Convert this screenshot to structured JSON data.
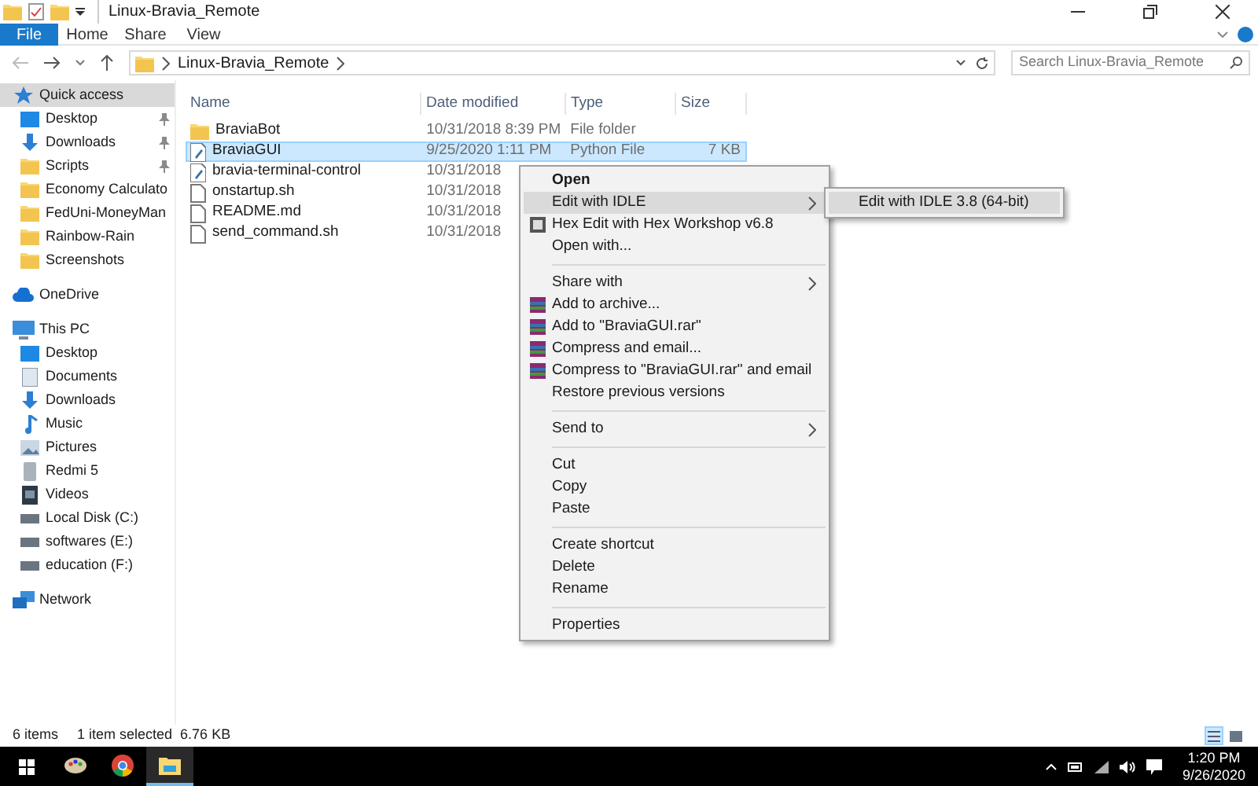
{
  "window": {
    "title": "Linux-Bravia_Remote"
  },
  "ribbon_tabs": [
    {
      "label": "File",
      "selected": true
    },
    {
      "label": "Home",
      "selected": false
    },
    {
      "label": "Share",
      "selected": false
    },
    {
      "label": "View",
      "selected": false
    }
  ],
  "address": {
    "path": "Linux-Bravia_Remote",
    "search_placeholder": "Search Linux-Bravia_Remote"
  },
  "nav": [
    {
      "label": "Quick access",
      "kind": "star",
      "selected": true,
      "children": [
        {
          "label": "Desktop",
          "kind": "desktop",
          "pinned": true
        },
        {
          "label": "Downloads",
          "kind": "download",
          "pinned": true
        },
        {
          "label": "Scripts",
          "kind": "folder",
          "pinned": true
        },
        {
          "label": "Economy Calculato",
          "kind": "folder",
          "pinned": false
        },
        {
          "label": "FedUni-MoneyMan",
          "kind": "folder",
          "pinned": false
        },
        {
          "label": "Rainbow-Rain",
          "kind": "folder",
          "pinned": false
        },
        {
          "label": "Screenshots",
          "kind": "folder",
          "pinned": false
        }
      ]
    },
    {
      "label": "OneDrive",
      "kind": "cloud",
      "selected": false
    },
    {
      "label": "This PC",
      "kind": "pc",
      "selected": false,
      "children": [
        {
          "label": "Desktop",
          "kind": "desktop"
        },
        {
          "label": "Documents",
          "kind": "document"
        },
        {
          "label": "Downloads",
          "kind": "download"
        },
        {
          "label": "Music",
          "kind": "music"
        },
        {
          "label": "Pictures",
          "kind": "pictures"
        },
        {
          "label": "Redmi 5",
          "kind": "phone"
        },
        {
          "label": "Videos",
          "kind": "video"
        },
        {
          "label": "Local Disk (C:)",
          "kind": "drive"
        },
        {
          "label": "softwares (E:)",
          "kind": "drive"
        },
        {
          "label": "education (F:)",
          "kind": "drive"
        }
      ]
    },
    {
      "label": "Network",
      "kind": "network",
      "selected": false
    }
  ],
  "table": {
    "columns": [
      "Name",
      "Date modified",
      "Type",
      "Size"
    ],
    "rows": [
      {
        "kind": "folder",
        "name": "BraviaBot",
        "date": "10/31/2018 8:39 PM",
        "type": "File folder",
        "size": "",
        "selected": false
      },
      {
        "kind": "python",
        "name": "BraviaGUI",
        "date": "9/25/2020 1:11 PM",
        "type": "Python File",
        "size": "7 KB",
        "selected": true
      },
      {
        "kind": "python",
        "name": "bravia-terminal-control",
        "date": "10/31/2018",
        "type": "",
        "size": "",
        "selected": false
      },
      {
        "kind": "text",
        "name": "onstartup.sh",
        "date": "10/31/2018",
        "type": "",
        "size": "",
        "selected": false
      },
      {
        "kind": "text",
        "name": "README.md",
        "date": "10/31/2018",
        "type": "",
        "size": "",
        "selected": false
      },
      {
        "kind": "text",
        "name": "send_command.sh",
        "date": "10/31/2018",
        "type": "",
        "size": "",
        "selected": false
      }
    ]
  },
  "context_menu": [
    {
      "kind": "item",
      "label": "Open",
      "default": true,
      "submenu": false,
      "selected": false
    },
    {
      "kind": "item",
      "label": "Edit with IDLE",
      "default": false,
      "submenu": true,
      "selected": true
    },
    {
      "kind": "hex",
      "label": "Hex Edit with Hex Workshop v6.8",
      "default": false,
      "submenu": false,
      "selected": false
    },
    {
      "kind": "item",
      "label": "Open with...",
      "default": false,
      "submenu": false,
      "selected": false
    },
    {
      "kind": "separator"
    },
    {
      "kind": "item",
      "label": "Share with",
      "default": false,
      "submenu": true,
      "selected": false
    },
    {
      "kind": "rar",
      "label": "Add to archive...",
      "default": false,
      "submenu": false,
      "selected": false
    },
    {
      "kind": "rar",
      "label": "Add to \"BraviaGUI.rar\"",
      "default": false,
      "submenu": false,
      "selected": false
    },
    {
      "kind": "rar",
      "label": "Compress and email...",
      "default": false,
      "submenu": false,
      "selected": false
    },
    {
      "kind": "rar",
      "label": "Compress to \"BraviaGUI.rar\" and email",
      "default": false,
      "submenu": false,
      "selected": false
    },
    {
      "kind": "item",
      "label": "Restore previous versions",
      "default": false,
      "submenu": false,
      "selected": false
    },
    {
      "kind": "separator"
    },
    {
      "kind": "item",
      "label": "Send to",
      "default": false,
      "submenu": true,
      "selected": false
    },
    {
      "kind": "separator"
    },
    {
      "kind": "item",
      "label": "Cut",
      "default": false,
      "submenu": false,
      "selected": false
    },
    {
      "kind": "item",
      "label": "Copy",
      "default": false,
      "submenu": false,
      "selected": false
    },
    {
      "kind": "item",
      "label": "Paste",
      "default": false,
      "submenu": false,
      "selected": false
    },
    {
      "kind": "separator"
    },
    {
      "kind": "item",
      "label": "Create shortcut",
      "default": false,
      "submenu": false,
      "selected": false
    },
    {
      "kind": "item",
      "label": "Delete",
      "default": false,
      "submenu": false,
      "selected": false
    },
    {
      "kind": "item",
      "label": "Rename",
      "default": false,
      "submenu": false,
      "selected": false
    },
    {
      "kind": "separator"
    },
    {
      "kind": "item",
      "label": "Properties",
      "default": false,
      "submenu": false,
      "selected": false
    }
  ],
  "submenu": [
    {
      "label": "Edit with IDLE 3.8 (64-bit)",
      "selected": true
    }
  ],
  "status_bar": {
    "count": "6 items",
    "selection": "1 item selected  6.76 KB",
    "views": [
      {
        "kind": "details",
        "selected": true
      },
      {
        "kind": "large",
        "selected": false
      }
    ]
  },
  "taskbar": {
    "apps": [
      {
        "kind": "paint",
        "active": false
      },
      {
        "kind": "chrome",
        "active": false
      },
      {
        "kind": "explorer",
        "active": true
      }
    ],
    "time": "1:20 PM",
    "date": "9/26/2020"
  }
}
